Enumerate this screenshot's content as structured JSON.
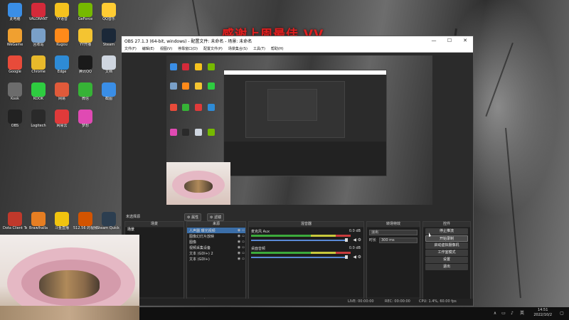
{
  "banner": {
    "text": "感谢上周最佳 VV"
  },
  "desktop": {
    "icons": [
      {
        "label": "此电脑",
        "color": "#3a8ee6"
      },
      {
        "label": "VALORANT",
        "color": "#d42a3a"
      },
      {
        "label": "YY语音",
        "color": "#f5c21e"
      },
      {
        "label": "GeForce",
        "color": "#76b900"
      },
      {
        "label": "QQ音乐",
        "color": "#ffcc33"
      },
      {
        "label": "WeGame",
        "color": "#f0a030"
      },
      {
        "label": "回收站",
        "color": "#7aa0c8"
      },
      {
        "label": "Kugou",
        "color": "#ff8a1a"
      },
      {
        "label": "YY开播",
        "color": "#f4c431"
      },
      {
        "label": "Steam",
        "color": "#1b2838"
      },
      {
        "label": "Google",
        "color": "#e84b3a"
      },
      {
        "label": "Chrome",
        "color": "#e8b92b"
      },
      {
        "label": "Edge",
        "color": "#2e8bd6"
      },
      {
        "label": "腾讯QQ",
        "color": "#1a1a1a"
      },
      {
        "label": "文档",
        "color": "#cfd6e0"
      },
      {
        "label": "Kook",
        "color": "#6c6c6c"
      },
      {
        "label": "KOOK",
        "color": "#2ecc40"
      },
      {
        "label": "网易",
        "color": "#e05a3a"
      },
      {
        "label": "微信",
        "color": "#36b336"
      },
      {
        "label": "截图",
        "color": "#3a8ee6"
      },
      {
        "label": "OBS",
        "color": "#222"
      },
      {
        "label": "Logitech",
        "color": "#2a2a2a"
      },
      {
        "label": "网易云",
        "color": "#e03a3a"
      },
      {
        "label": "梦想",
        "color": "#e04ab3"
      }
    ],
    "bottom_labels": [
      "Dota Client Terminator",
      "Brawlhalla",
      "斗鱼直播",
      "512.56 的视频",
      "Steam Quick Run"
    ]
  },
  "obs": {
    "title": "OBS 27.1.3 (64-bit, windows) - 配置文件: 未命名 - 场景: 未命名",
    "menu": [
      "文件(F)",
      "编辑(E)",
      "视图(V)",
      "停靠窗口(D)",
      "配置文件(P)",
      "场景集合(S)",
      "工具(T)",
      "帮助(H)"
    ],
    "no_source_label": "未选择源",
    "properties_btn": "属性",
    "filters_btn": "滤镜",
    "docks": {
      "scenes": {
        "title": "场景",
        "items": [
          "场景"
        ]
      },
      "sources": {
        "title": "来源",
        "items": [
          "人声器 曝光视频",
          "图像幻灯片放映",
          "图像",
          "视频采集设备",
          "文本 (GDI+) 2",
          "文本 (GDI+)"
        ]
      },
      "mixer": {
        "title": "混音器",
        "channels": [
          {
            "name": "麦克风 Aux",
            "db": "0.0 dB"
          },
          {
            "name": "桌面音频",
            "db": "0.0 dB"
          }
        ]
      },
      "transitions": {
        "title": "转场特效",
        "type": "淡出",
        "duration_label": "时长",
        "duration_value": "300 ms"
      },
      "controls": {
        "title": "控件",
        "buttons": [
          "停止推流",
          "开始录制",
          "启动虚拟摄像机",
          "工作室模式",
          "设置",
          "退出"
        ]
      }
    },
    "status": {
      "live": "LIVE: 00:00:00",
      "rec": "REC: 00:00:00",
      "cpu": "CPU: 1.4%, 60.00 fps"
    }
  },
  "taskbar": {
    "time": "14:51",
    "date": "2022/10/2",
    "lang": "英"
  }
}
